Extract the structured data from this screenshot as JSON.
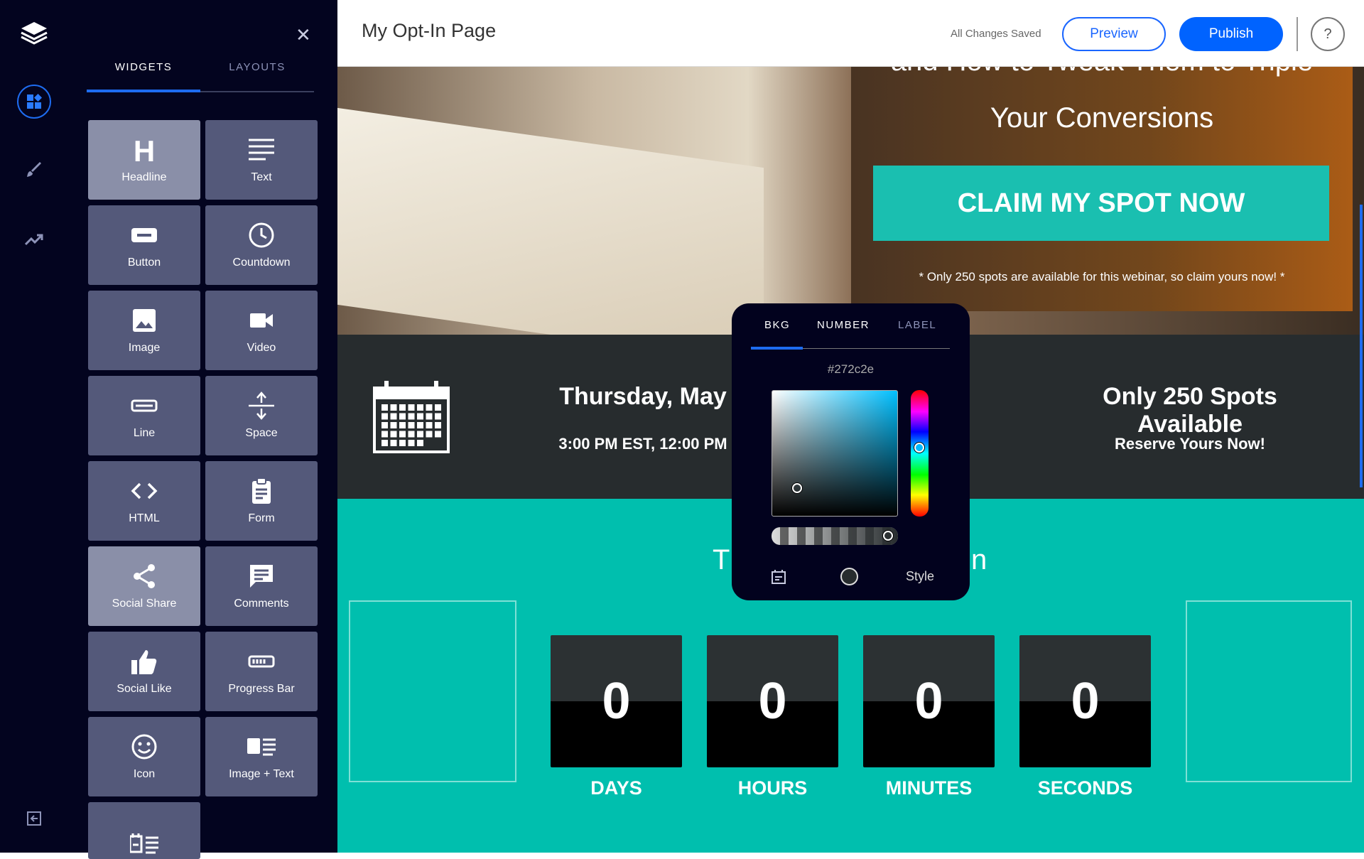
{
  "sidebar": {
    "rail": [
      {
        "icon": "layers-logo-icon"
      },
      {
        "icon": "widgets-icon",
        "active": true
      },
      {
        "icon": "brush-icon"
      },
      {
        "icon": "analytics-icon"
      },
      {
        "icon": "exit-icon"
      }
    ],
    "tabs": [
      {
        "label": "WIDGETS",
        "active": true
      },
      {
        "label": "LAYOUTS"
      }
    ],
    "widgets": [
      "Headline",
      "Text",
      "Button",
      "Countdown",
      "Image",
      "Video",
      "Line",
      "Space",
      "HTML",
      "Form",
      "Social Share",
      "Comments",
      "Social Like",
      "Progress Bar",
      "Icon",
      "Image + Text",
      ""
    ]
  },
  "header": {
    "title": "My Opt-In Page",
    "status": "All Changes Saved",
    "preview": "Preview",
    "publish": "Publish",
    "help": "?"
  },
  "hero": {
    "line1": "and How to Tweak Them to Triple",
    "line2": "Your Conversions",
    "cta": "CLAIM MY SPOT NOW",
    "note": "* Only 250 spots are available for this webinar, so claim yours now! *"
  },
  "event": {
    "date": "Thursday, May",
    "time": "3:00 PM EST, 12:00 PM",
    "spots": "Only 250 Spots Available",
    "reserve": "Reserve Yours Now!"
  },
  "countdown": {
    "heading_left": "T",
    "heading_right": "n",
    "units": [
      {
        "value": "0",
        "label": "DAYS"
      },
      {
        "value": "0",
        "label": "HOURS"
      },
      {
        "value": "0",
        "label": "MINUTES"
      },
      {
        "value": "0",
        "label": "SECONDS"
      }
    ]
  },
  "picker": {
    "tabs": [
      "BKG",
      "NUMBER",
      "LABEL"
    ],
    "active_tab": "BKG",
    "hex": "#272c2e",
    "style": "Style"
  },
  "colors": {
    "accent": "#0063ff",
    "teal": "#00bfae",
    "band": "#272c2e",
    "sidebar": "#03041f"
  }
}
